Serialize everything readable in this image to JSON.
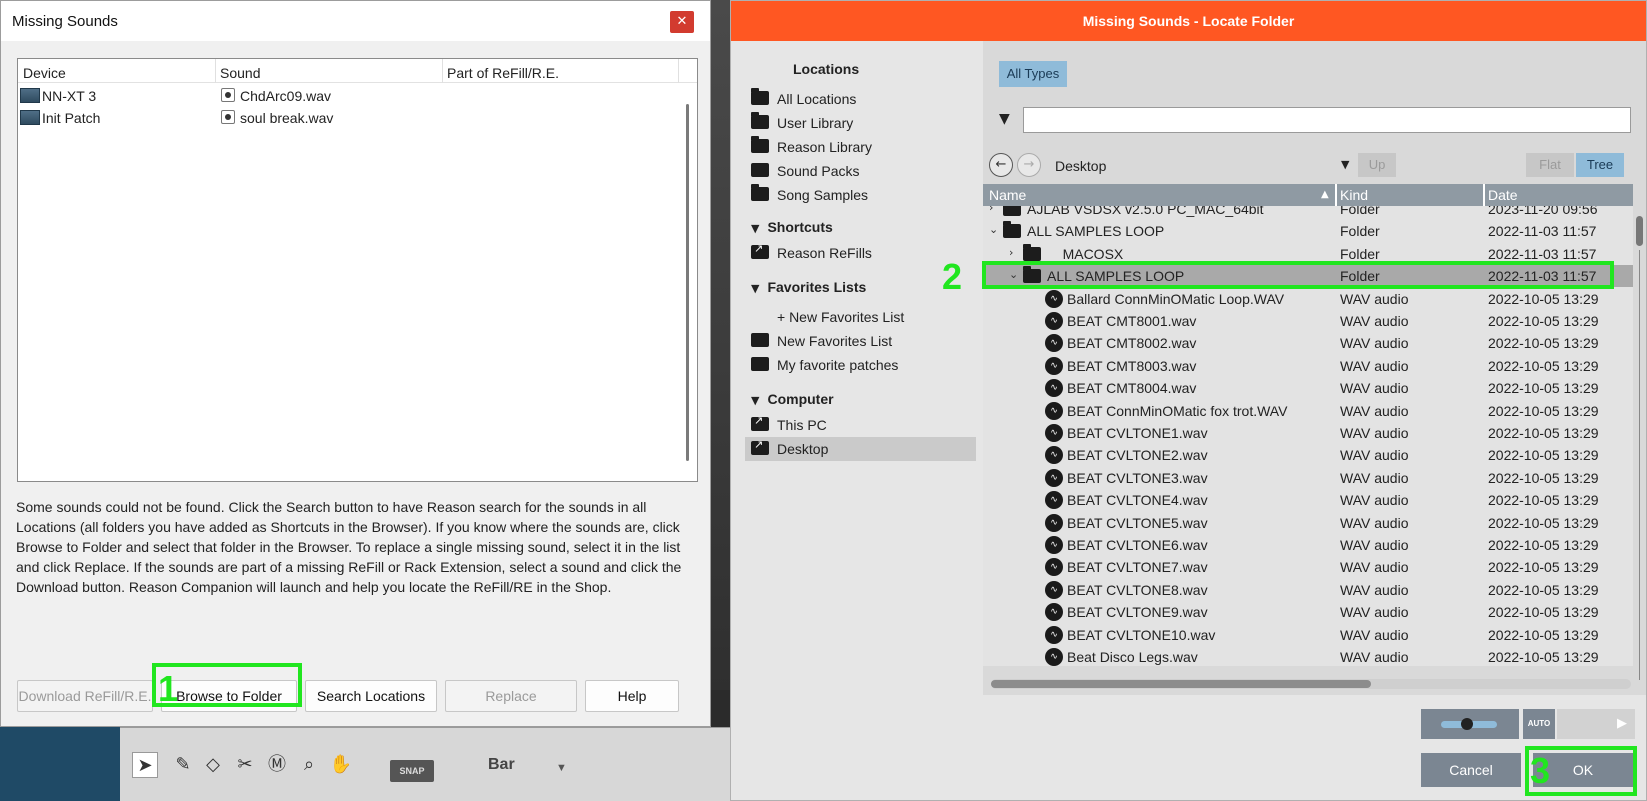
{
  "missing_dialog": {
    "title": "Missing Sounds",
    "columns": [
      "Device",
      "Sound",
      "Part of ReFill/R.E."
    ],
    "rows": [
      {
        "device": "NN-XT 3",
        "sound": "ChdArc09.wav",
        "part": ""
      },
      {
        "device": "Init Patch",
        "sound": "soul break.wav",
        "part": ""
      }
    ],
    "description": "Some sounds could not be found. Click the Search button to have Reason search for the sounds in all Locations (all folders you have added as Shortcuts in the Browser). If you know where the sounds are, click Browse to Folder and select that folder in the Browser. To replace a single missing sound, select it in the list and click Replace. If the sounds are part of a missing ReFill or Rack Extension, select a sound and click the Download button. Reason Companion will launch and help you locate the ReFill/RE in the Shop.",
    "buttons": {
      "download": "Download ReFill/R.E.",
      "browse": "Browse to Folder",
      "search": "Search Locations",
      "replace": "Replace",
      "help": "Help"
    },
    "close_icon": "✕"
  },
  "locate_dialog": {
    "title": "Missing Sounds - Locate Folder",
    "sidebar": {
      "locations_heading": "Locations",
      "locations": [
        "All Locations",
        "User Library",
        "Reason Library",
        "Sound Packs",
        "Song Samples"
      ],
      "shortcuts_heading": "Shortcuts",
      "shortcuts": [
        "Reason ReFills"
      ],
      "favorites_heading": "Favorites Lists",
      "favorites": [
        "+ New Favorites List",
        "New Favorites List",
        "My favorite patches"
      ],
      "computer_heading": "Computer",
      "computer": [
        "This PC",
        "Desktop"
      ],
      "selected": "Desktop"
    },
    "filter": {
      "all_types": "All Types",
      "search_value": ""
    },
    "nav": {
      "path": "Desktop",
      "up": "Up",
      "flat": "Flat",
      "tree": "Tree"
    },
    "columns": {
      "name": "Name",
      "kind": "Kind",
      "date": "Date"
    },
    "files": [
      {
        "name": "AJLAB VSDSX v2.5.0 PC_MAC_64bit",
        "kind": "Folder",
        "date": "2023-11-20 09:56",
        "type": "folder",
        "level": 0,
        "expander": "›"
      },
      {
        "name": "ALL SAMPLES LOOP",
        "kind": "Folder",
        "date": "2022-11-03 11:57",
        "type": "folder",
        "level": 0,
        "expander": "⌄"
      },
      {
        "name": "__MACOSX",
        "kind": "Folder",
        "date": "2022-11-03 11:57",
        "type": "folder",
        "level": 1,
        "expander": "›"
      },
      {
        "name": "ALL SAMPLES LOOP",
        "kind": "Folder",
        "date": "2022-11-03 11:57",
        "type": "folder",
        "level": 1,
        "expander": "⌄",
        "selected": true
      },
      {
        "name": "Ballard ConnMinOMatic Loop.WAV",
        "kind": "WAV audio",
        "date": "2022-10-05 13:29",
        "type": "wav",
        "level": 2
      },
      {
        "name": "BEAT CMT8001.wav",
        "kind": "WAV audio",
        "date": "2022-10-05 13:29",
        "type": "wav",
        "level": 2
      },
      {
        "name": "BEAT CMT8002.wav",
        "kind": "WAV audio",
        "date": "2022-10-05 13:29",
        "type": "wav",
        "level": 2
      },
      {
        "name": "BEAT CMT8003.wav",
        "kind": "WAV audio",
        "date": "2022-10-05 13:29",
        "type": "wav",
        "level": 2
      },
      {
        "name": "BEAT CMT8004.wav",
        "kind": "WAV audio",
        "date": "2022-10-05 13:29",
        "type": "wav",
        "level": 2
      },
      {
        "name": "BEAT ConnMinOMatic fox trot.WAV",
        "kind": "WAV audio",
        "date": "2022-10-05 13:29",
        "type": "wav",
        "level": 2
      },
      {
        "name": "BEAT CVLTONE1.wav",
        "kind": "WAV audio",
        "date": "2022-10-05 13:29",
        "type": "wav",
        "level": 2
      },
      {
        "name": "BEAT CVLTONE2.wav",
        "kind": "WAV audio",
        "date": "2022-10-05 13:29",
        "type": "wav",
        "level": 2
      },
      {
        "name": "BEAT CVLTONE3.wav",
        "kind": "WAV audio",
        "date": "2022-10-05 13:29",
        "type": "wav",
        "level": 2
      },
      {
        "name": "BEAT CVLTONE4.wav",
        "kind": "WAV audio",
        "date": "2022-10-05 13:29",
        "type": "wav",
        "level": 2
      },
      {
        "name": "BEAT CVLTONE5.wav",
        "kind": "WAV audio",
        "date": "2022-10-05 13:29",
        "type": "wav",
        "level": 2
      },
      {
        "name": "BEAT CVLTONE6.wav",
        "kind": "WAV audio",
        "date": "2022-10-05 13:29",
        "type": "wav",
        "level": 2
      },
      {
        "name": "BEAT CVLTONE7.wav",
        "kind": "WAV audio",
        "date": "2022-10-05 13:29",
        "type": "wav",
        "level": 2
      },
      {
        "name": "BEAT CVLTONE8.wav",
        "kind": "WAV audio",
        "date": "2022-10-05 13:29",
        "type": "wav",
        "level": 2
      },
      {
        "name": "BEAT CVLTONE9.wav",
        "kind": "WAV audio",
        "date": "2022-10-05 13:29",
        "type": "wav",
        "level": 2
      },
      {
        "name": "BEAT CVLTONE10.wav",
        "kind": "WAV audio",
        "date": "2022-10-05 13:29",
        "type": "wav",
        "level": 2
      },
      {
        "name": "Beat Disco Legs.wav",
        "kind": "WAV audio",
        "date": "2022-10-05 13:29",
        "type": "wav",
        "level": 2
      }
    ],
    "bottom": {
      "auto": "AUTO",
      "cancel": "Cancel",
      "ok": "OK"
    }
  },
  "annotations": {
    "one": "1",
    "two": "2",
    "three": "3"
  },
  "daw_toolbar": {
    "snap": "SNAP",
    "bar": "Bar"
  },
  "colors": {
    "locate_title_bar": "#ff5722",
    "highlight": "#21e61f",
    "selected_blue": "#8fbbd9"
  }
}
